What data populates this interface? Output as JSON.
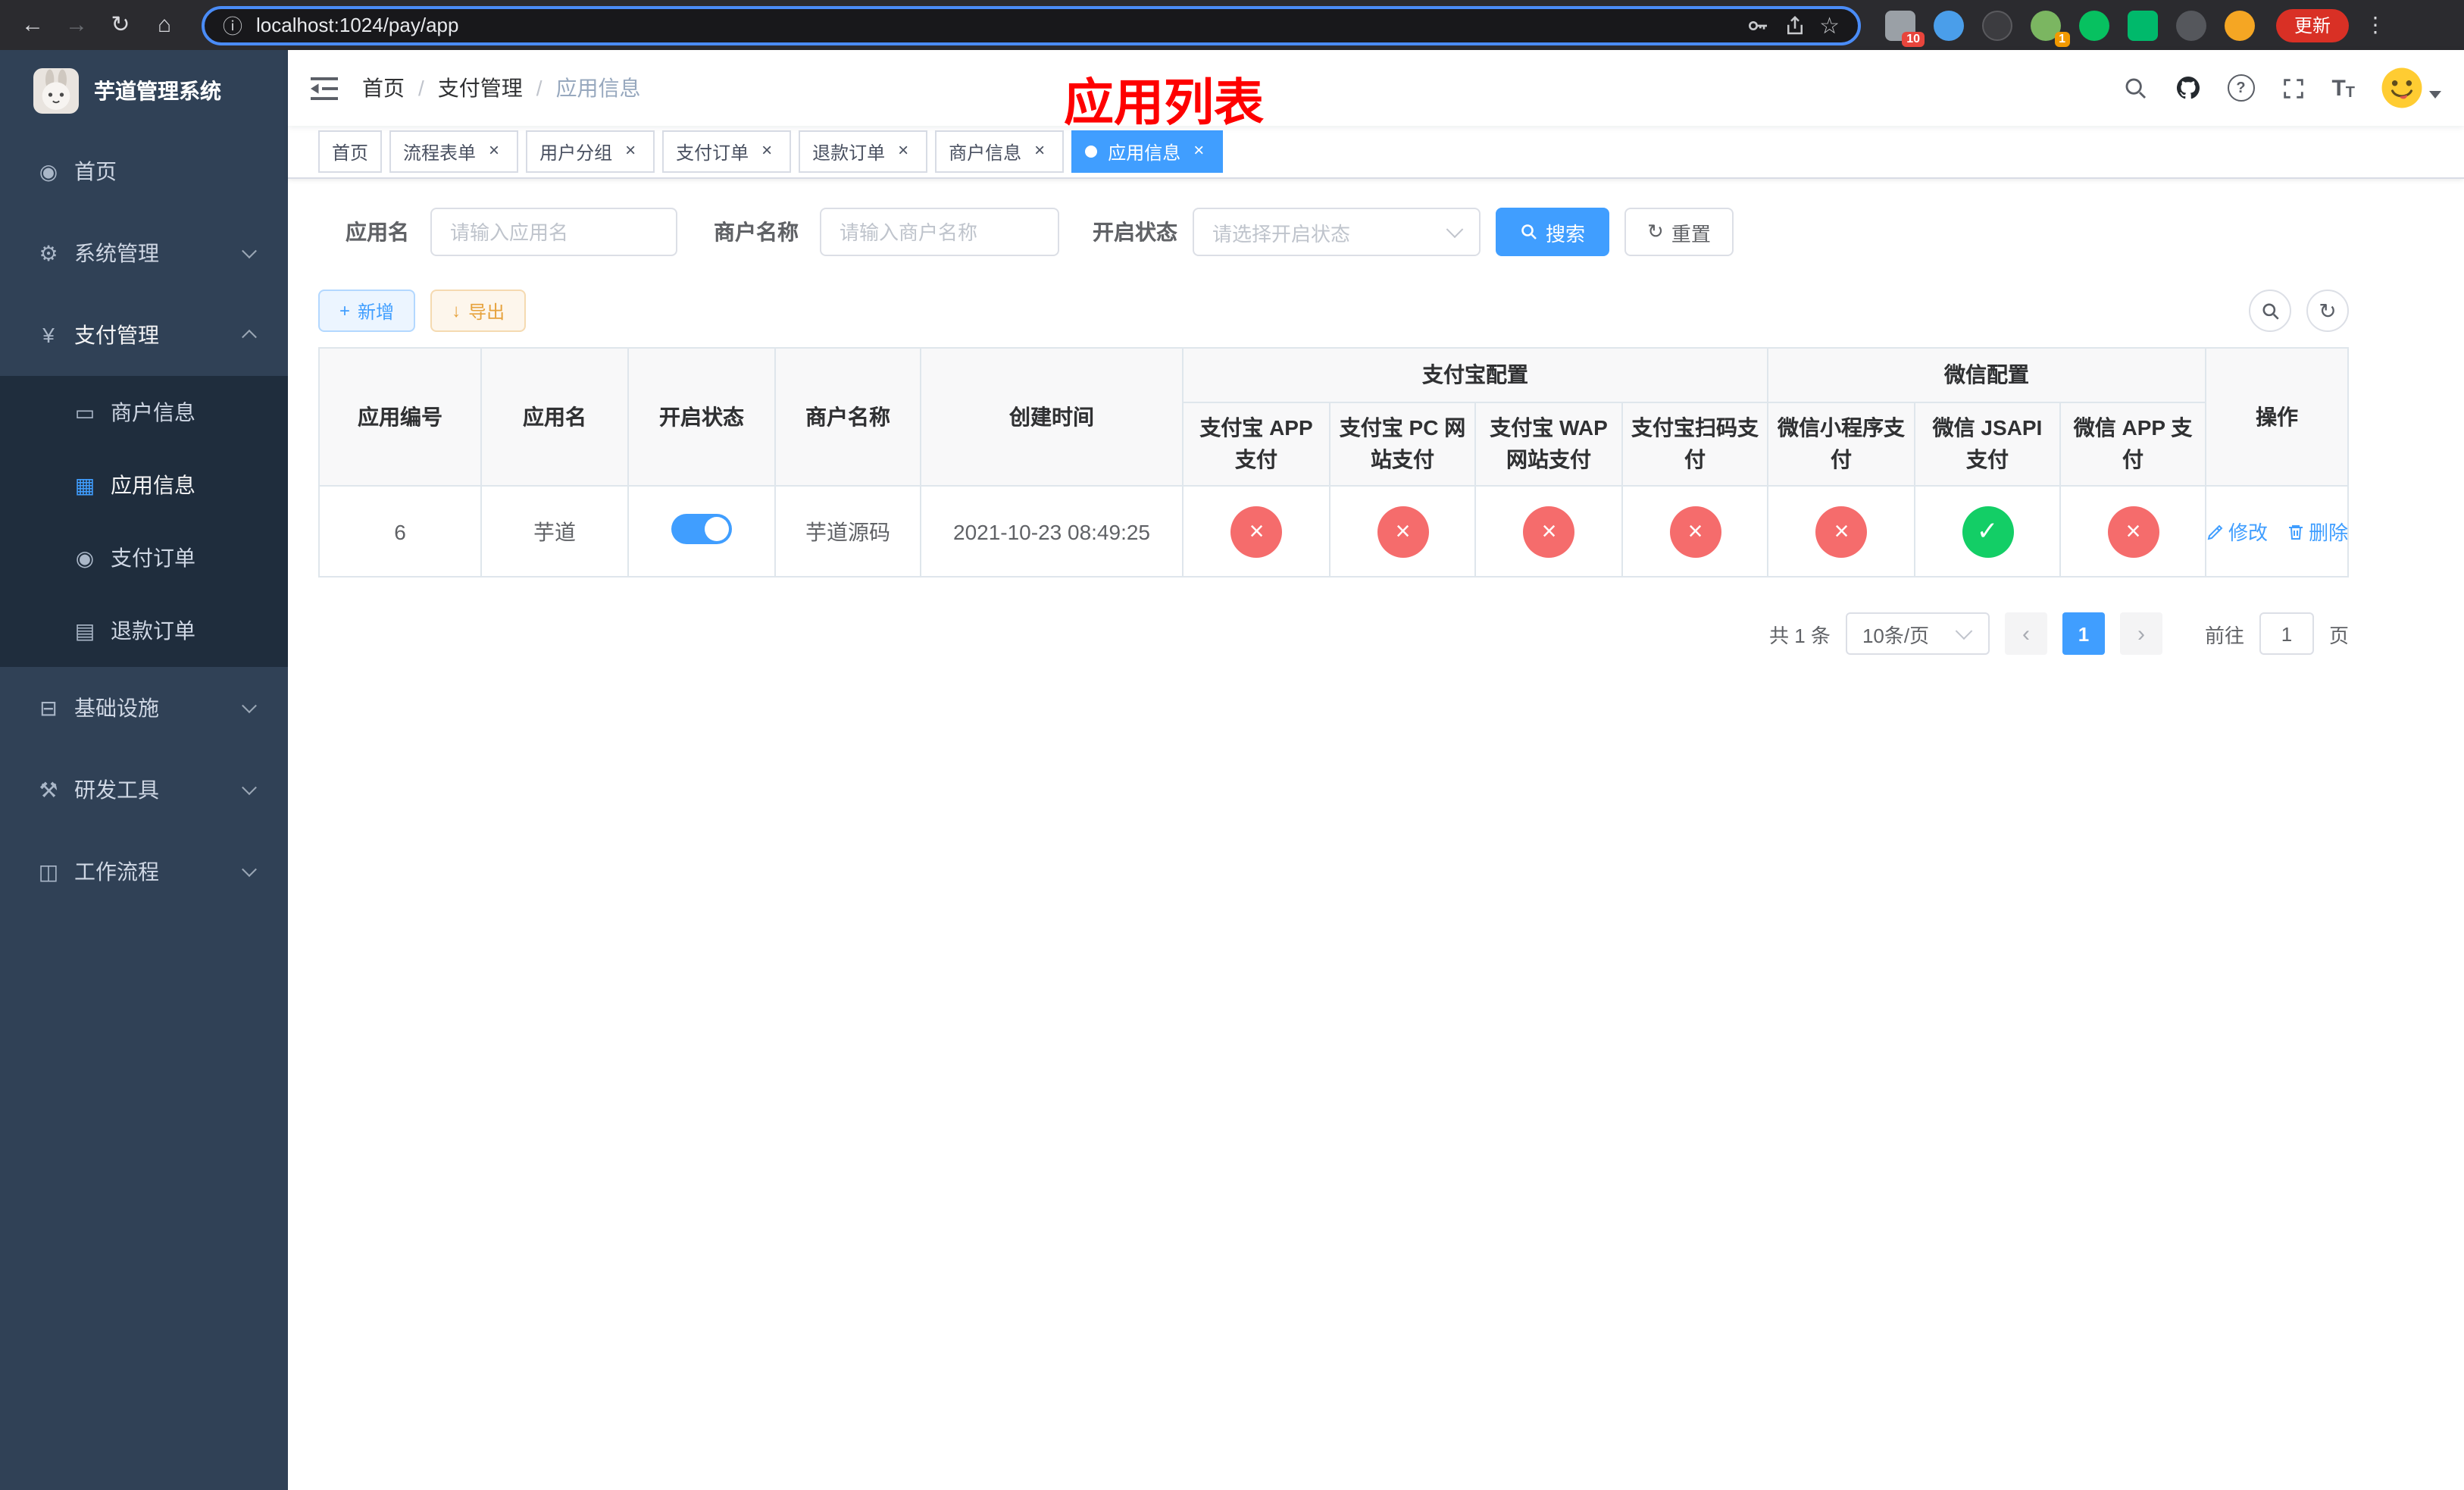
{
  "icons": {
    "back": "←",
    "forward": "→",
    "reload": "↻",
    "home": "⌂",
    "info": "ⓘ",
    "star": "☆",
    "kebab": "⋮",
    "download": "↓",
    "plus": "+",
    "close": "×",
    "check": "✓",
    "cross": "×",
    "refresh": "↻",
    "prev": "‹",
    "next": "›",
    "dashboard": "◉",
    "gear": "⚙",
    "yen": "¥",
    "card": "▭",
    "grid": "▦",
    "order": "◉",
    "doc": "▤",
    "infra": "⊟",
    "tools": "⚒",
    "flow": "◫",
    "font_large": "T",
    "font_small": "T",
    "question": "?"
  },
  "browser": {
    "url": "localhost:1024/pay/app",
    "update_label": "更新",
    "ext_badge_1": "10",
    "ext_badge_2": "1"
  },
  "sidebar": {
    "title": "芋道管理系统",
    "home": "首页",
    "system": "系统管理",
    "payment": "支付管理",
    "merchant_info": "商户信息",
    "app_info": "应用信息",
    "payment_order": "支付订单",
    "refund_order": "退款订单",
    "infrastructure": "基础设施",
    "dev_tools": "研发工具",
    "workflow": "工作流程"
  },
  "header": {
    "breadcrumb": {
      "home": "首页",
      "payment": "支付管理",
      "current": "应用信息",
      "sep": "/"
    },
    "annotation": "应用列表"
  },
  "tabs": {
    "t0": "首页",
    "t1": "流程表单",
    "t2": "用户分组",
    "t3": "支付订单",
    "t4": "退款订单",
    "t5": "商户信息",
    "t6": "应用信息"
  },
  "filters": {
    "app_name_label": "应用名",
    "app_name_placeholder": "请输入应用名",
    "merchant_label": "商户名称",
    "merchant_placeholder": "请输入商户名称",
    "status_label": "开启状态",
    "status_placeholder": "请选择开启状态",
    "search_label": "搜索",
    "reset_label": "重置"
  },
  "toolbar": {
    "add_label": "新增",
    "export_label": "导出"
  },
  "table": {
    "group_alipay": "支付宝配置",
    "group_wechat": "微信配置",
    "col_id": "应用编号",
    "col_name": "应用名",
    "col_status": "开启状态",
    "col_merchant": "商户名称",
    "col_created": "创建时间",
    "col_alipay_app": "支付宝 APP 支付",
    "col_alipay_pc": "支付宝 PC 网站支付",
    "col_alipay_wap": "支付宝 WAP 网站支付",
    "col_alipay_qr": "支付宝扫码支付",
    "col_wx_mini": "微信小程序支付",
    "col_wx_jsapi": "微信 JSAPI 支付",
    "col_wx_app": "微信 APP 支付",
    "col_actions": "操作",
    "row": {
      "id": "6",
      "name": "芋道",
      "enabled": true,
      "merchant": "芋道源码",
      "created": "2021-10-23 08:49:25",
      "alipay_app": false,
      "alipay_pc": false,
      "alipay_wap": false,
      "alipay_qr": false,
      "wx_mini": false,
      "wx_jsapi": true,
      "wx_app": false,
      "edit_label": "修改",
      "delete_label": "删除"
    }
  },
  "pagination": {
    "total": "共 1 条",
    "page_size": "10条/页",
    "current_page": "1",
    "goto_label": "前往",
    "goto_value": "1",
    "unit_label": "页"
  }
}
